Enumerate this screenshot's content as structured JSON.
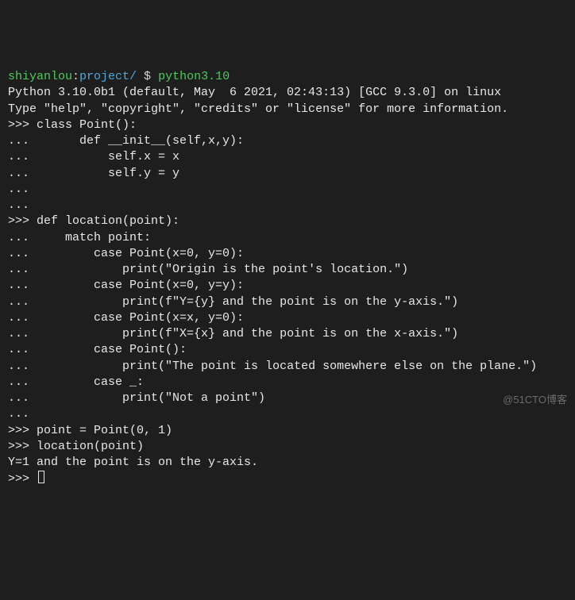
{
  "prompt": {
    "user": "shiyanlou",
    "sep1": ":",
    "path": "project/",
    "dollar": " $ ",
    "command": "python3.10"
  },
  "banner": {
    "line1": "Python 3.10.0b1 (default, May  6 2021, 02:43:13) [GCC 9.3.0] on linux",
    "line2": "Type \"help\", \"copyright\", \"credits\" or \"license\" for more information."
  },
  "ps1": ">>> ",
  "ps2": "... ",
  "session": {
    "l01": "class Point():",
    "l02": "      def __init__(self,x,y):",
    "l03": "          self.x = x",
    "l04": "          self.y = y",
    "l05": "",
    "l06": "",
    "l07": "def location(point):",
    "l08": "    match point:",
    "l09": "        case Point(x=0, y=0):",
    "l10": "            print(\"Origin is the point's location.\")",
    "l11": "        case Point(x=0, y=y):",
    "l12": "            print(f\"Y={y} and the point is on the y-axis.\")",
    "l13": "        case Point(x=x, y=0):",
    "l14": "            print(f\"X={x} and the point is on the x-axis.\")",
    "l15": "        case Point():",
    "l16": "            print(\"The point is located somewhere else on the plane.\")",
    "l17": "        case _:",
    "l18": "            print(\"Not a point\")",
    "l19": "",
    "l20": "point = Point(0, 1)",
    "l21": "location(point)"
  },
  "output": {
    "result": "Y=1 and the point is on the y-axis."
  },
  "watermark": "@51CTO博客"
}
